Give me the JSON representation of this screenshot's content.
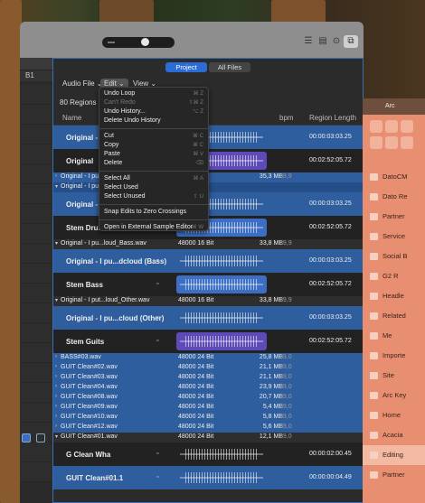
{
  "colors": {
    "selection": "#2f5e9f",
    "accent": "#2c6cd6",
    "arc_bg": "#e98f71"
  },
  "left_panel": {
    "marker": "B1"
  },
  "browser": {
    "tabs": [
      {
        "label": "Project",
        "active": true
      },
      {
        "label": "All Files",
        "active": false
      }
    ],
    "menus": [
      "Audio File",
      "Edit",
      "View"
    ],
    "regions_count": "80 Regions and",
    "columns": {
      "name": "Name",
      "bpm": "bpm",
      "length": "Region Length"
    },
    "rows": [
      {
        "kind": "tall",
        "style": "blue",
        "name": "Original - I pu",
        "wave": "gray",
        "length": "00:00:03:03.25"
      },
      {
        "kind": "tall",
        "style": "dark",
        "name": "Original",
        "wave": "purple",
        "length": "00:02:52:05.72"
      },
      {
        "kind": "short",
        "style": "blue",
        "name": "Original - I put...",
        "format": "",
        "size": "35,3 MB",
        "bpm": "89,9"
      },
      {
        "kind": "short",
        "style": "bluehdr",
        "name": "Original - I put...",
        "format": "",
        "size": "",
        "bpm": ""
      },
      {
        "kind": "tall",
        "style": "blue",
        "name": "Original - I pu",
        "wave": "gray",
        "length": "00:00:03:03.25"
      },
      {
        "kind": "tall",
        "style": "dark",
        "name": "Stem Drums",
        "wave": "bluew",
        "length": "00:02:52:05.72"
      },
      {
        "kind": "short",
        "style": "grayh",
        "name": "Original - I pu...loud_Bass.wav",
        "format": "48000 16 Bit",
        "size": "33,8 MB",
        "bpm": "89,9"
      },
      {
        "kind": "tall",
        "style": "blue",
        "name": "Original - I pu...dcloud (Bass)",
        "wave": "gray",
        "length": "00:00:03:03.25"
      },
      {
        "kind": "tall",
        "style": "dark",
        "name": "Stem Bass",
        "wave": "bluew",
        "length": "00:02:52:05.72"
      },
      {
        "kind": "short",
        "style": "grayh",
        "name": "Original - I put...loud_Other.wav",
        "format": "48000 16 Bit",
        "size": "33,8 MB",
        "bpm": "89,9"
      },
      {
        "kind": "tall",
        "style": "blue",
        "name": "Original - I pu...cloud (Other)",
        "wave": "gray",
        "length": "00:00:03:03.25"
      },
      {
        "kind": "tall",
        "style": "dark",
        "name": "Stem Guits",
        "wave": "purple",
        "length": "00:02:52:05.72"
      },
      {
        "kind": "short",
        "style": "blue",
        "name": "BASS#03.wav",
        "format": "48000 24 Bit",
        "size": "25,8 MB",
        "bpm": "89,0"
      },
      {
        "kind": "short",
        "style": "blue",
        "name": "GUIT Clean#02.wav",
        "format": "48000 24 Bit",
        "size": "21,1 MB",
        "bpm": "89,0"
      },
      {
        "kind": "short",
        "style": "blue",
        "name": "GUIT Clean#03.wav",
        "format": "48000 24 Bit",
        "size": "21,1 MB",
        "bpm": "89,0"
      },
      {
        "kind": "short",
        "style": "blue",
        "name": "GUIT Clean#04.wav",
        "format": "48000 24 Bit",
        "size": "23,9 MB",
        "bpm": "89,0"
      },
      {
        "kind": "short",
        "style": "blue",
        "name": "GUIT Clean#08.wav",
        "format": "48000 24 Bit",
        "size": "20,7 MB",
        "bpm": "89,0"
      },
      {
        "kind": "short",
        "style": "blue",
        "name": "GUIT Clean#09.wav",
        "format": "48000 24 Bit",
        "size": "5,4 MB",
        "bpm": "89,0"
      },
      {
        "kind": "short",
        "style": "blue",
        "name": "GUIT Clean#10.wav",
        "format": "48000 24 Bit",
        "size": "5,8 MB",
        "bpm": "89,0"
      },
      {
        "kind": "short",
        "style": "blue",
        "name": "GUIT Clean#12.wav",
        "format": "48000 24 Bit",
        "size": "5,6 MB",
        "bpm": "89,0"
      },
      {
        "kind": "short",
        "style": "grayh",
        "name": "GUIT Clean#01.wav",
        "format": "48000 24 Bit",
        "size": "12,1 MB",
        "bpm": "89,0"
      },
      {
        "kind": "tall",
        "style": "dark",
        "name": "G Clean Wha",
        "wave": "gray",
        "length": "00:00:02:00.45"
      },
      {
        "kind": "tall",
        "style": "blue",
        "name": "GUIT Clean#01.1",
        "wave": "gray",
        "length": "00:00:00:04.49"
      }
    ]
  },
  "edit_menu": {
    "items": [
      {
        "label": "Undo Loop",
        "shortcut": "⌘ Z",
        "disabled": false
      },
      {
        "label": "Can't Redo",
        "shortcut": "⇧⌘ Z",
        "disabled": true
      },
      {
        "label": "Undo History...",
        "shortcut": "⌥ Z",
        "disabled": false
      },
      {
        "label": "Delete Undo History",
        "shortcut": "",
        "disabled": false
      },
      {
        "sep": true
      },
      {
        "label": "Cut",
        "shortcut": "⌘ C",
        "disabled": false
      },
      {
        "label": "Copy",
        "shortcut": "⌘ C",
        "disabled": false
      },
      {
        "label": "Paste",
        "shortcut": "⌘ V",
        "disabled": false
      },
      {
        "label": "Delete",
        "shortcut": "⌫",
        "disabled": false
      },
      {
        "sep": true
      },
      {
        "label": "Select All",
        "shortcut": "⌘ A",
        "disabled": false
      },
      {
        "label": "Select Used",
        "shortcut": "",
        "disabled": false
      },
      {
        "label": "Select Unused",
        "shortcut": "⇧ U",
        "disabled": false
      },
      {
        "sep": true
      },
      {
        "label": "Snap Edits to Zero Crossings",
        "shortcut": "",
        "disabled": false
      },
      {
        "sep": true
      },
      {
        "label": "Open in External Sample Editor",
        "shortcut": "⌘ W",
        "disabled": false
      }
    ]
  },
  "arc": {
    "top_label": "Arc",
    "items": [
      {
        "label": "DatoCM",
        "active": false
      },
      {
        "label": "Dato Re",
        "active": false
      },
      {
        "label": "Partner",
        "active": false
      },
      {
        "label": "Service",
        "active": false
      },
      {
        "label": "Social B",
        "active": false
      },
      {
        "label": "G2 R",
        "active": false
      },
      {
        "label": "Headle",
        "active": false
      },
      {
        "label": "Related",
        "active": false
      },
      {
        "label": "Me",
        "active": false
      },
      {
        "label": "Importe",
        "active": false
      },
      {
        "label": "Site",
        "active": false
      },
      {
        "label": "Arc Key",
        "active": false
      },
      {
        "label": "Home",
        "active": false
      },
      {
        "label": "Acacia",
        "active": false
      },
      {
        "label": "Editing",
        "active": true
      },
      {
        "label": "Partner",
        "active": false
      }
    ]
  }
}
